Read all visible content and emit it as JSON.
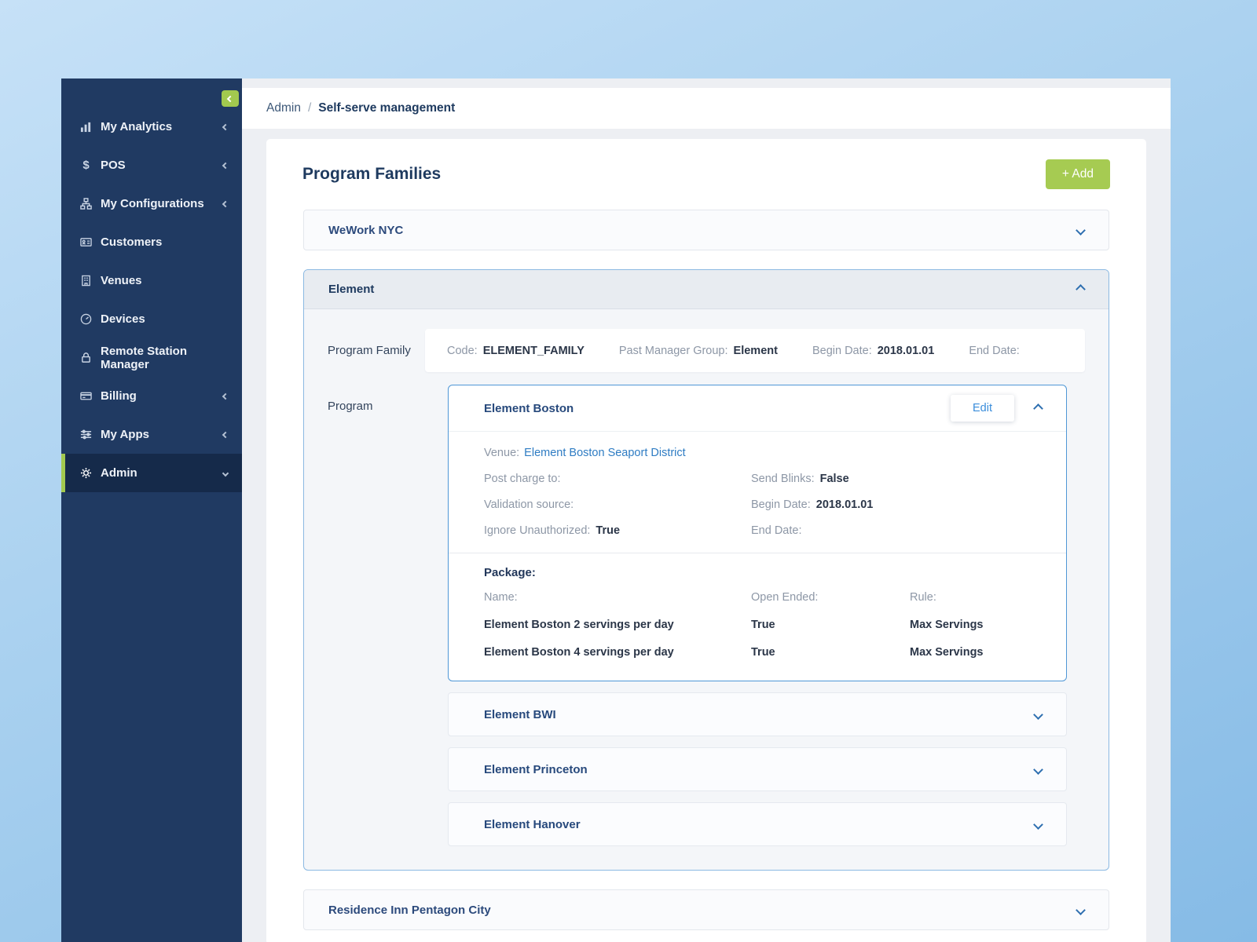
{
  "colors": {
    "accent_green": "#a2c94f",
    "navy": "#1e3a5f",
    "link_blue": "#2e7cc3",
    "sidebar_bg": "#203a62"
  },
  "sidebar": {
    "items": [
      {
        "label": "My Analytics",
        "icon": "bar-chart-icon"
      },
      {
        "label": "POS",
        "icon": "dollar-icon"
      },
      {
        "label": "My Configurations",
        "icon": "sitemap-icon"
      },
      {
        "label": "Customers",
        "icon": "id-card-icon"
      },
      {
        "label": "Venues",
        "icon": "building-icon"
      },
      {
        "label": "Devices",
        "icon": "gauge-icon"
      },
      {
        "label": "Remote Station Manager",
        "icon": "lock-icon"
      },
      {
        "label": "Billing",
        "icon": "credit-card-icon"
      },
      {
        "label": "My Apps",
        "icon": "sliders-icon"
      },
      {
        "label": "Admin",
        "icon": "gear-icon"
      }
    ]
  },
  "breadcrumb": {
    "root": "Admin",
    "sep": "/",
    "current": "Self-serve management"
  },
  "page": {
    "title": "Program Families",
    "add_label": "+ Add"
  },
  "families": {
    "wework": {
      "label": "WeWork NYC"
    },
    "residence": {
      "label": "Residence Inn Pentagon City"
    },
    "element": {
      "label": "Element",
      "section_labels": {
        "family": "Program Family",
        "program": "Program"
      },
      "family_details": {
        "code_label": "Code:",
        "code_value": "ELEMENT_FAMILY",
        "manager_label": "Past Manager Group:",
        "manager_value": "Element",
        "begin_label": "Begin Date:",
        "begin_value": "2018.01.01",
        "end_label": "End Date:",
        "end_value": ""
      },
      "programs": {
        "boston": {
          "label": "Element Boston",
          "edit_label": "Edit",
          "fields": {
            "venue_label": "Venue:",
            "venue_value": "Element Boston Seaport District",
            "post_charge_label": "Post charge to:",
            "post_charge_value": "",
            "validation_label": "Validation source:",
            "validation_value": "",
            "ignore_label": "Ignore Unauthorized:",
            "ignore_value": "True",
            "send_blinks_label": "Send Blinks:",
            "send_blinks_value": "False",
            "begin_label": "Begin Date:",
            "begin_value": "2018.01.01",
            "end_label": "End Date:",
            "end_value": ""
          },
          "package": {
            "title": "Package:",
            "headers": {
              "name": "Name:",
              "open_ended": "Open Ended:",
              "rule": "Rule:"
            },
            "rows": [
              {
                "name": "Element Boston 2 servings per day",
                "open_ended": "True",
                "rule": "Max Servings"
              },
              {
                "name": "Element Boston 4 servings per day",
                "open_ended": "True",
                "rule": "Max Servings"
              }
            ]
          }
        },
        "collapsed": [
          {
            "label": "Element BWI"
          },
          {
            "label": "Element Princeton"
          },
          {
            "label": "Element Hanover"
          }
        ]
      }
    }
  }
}
